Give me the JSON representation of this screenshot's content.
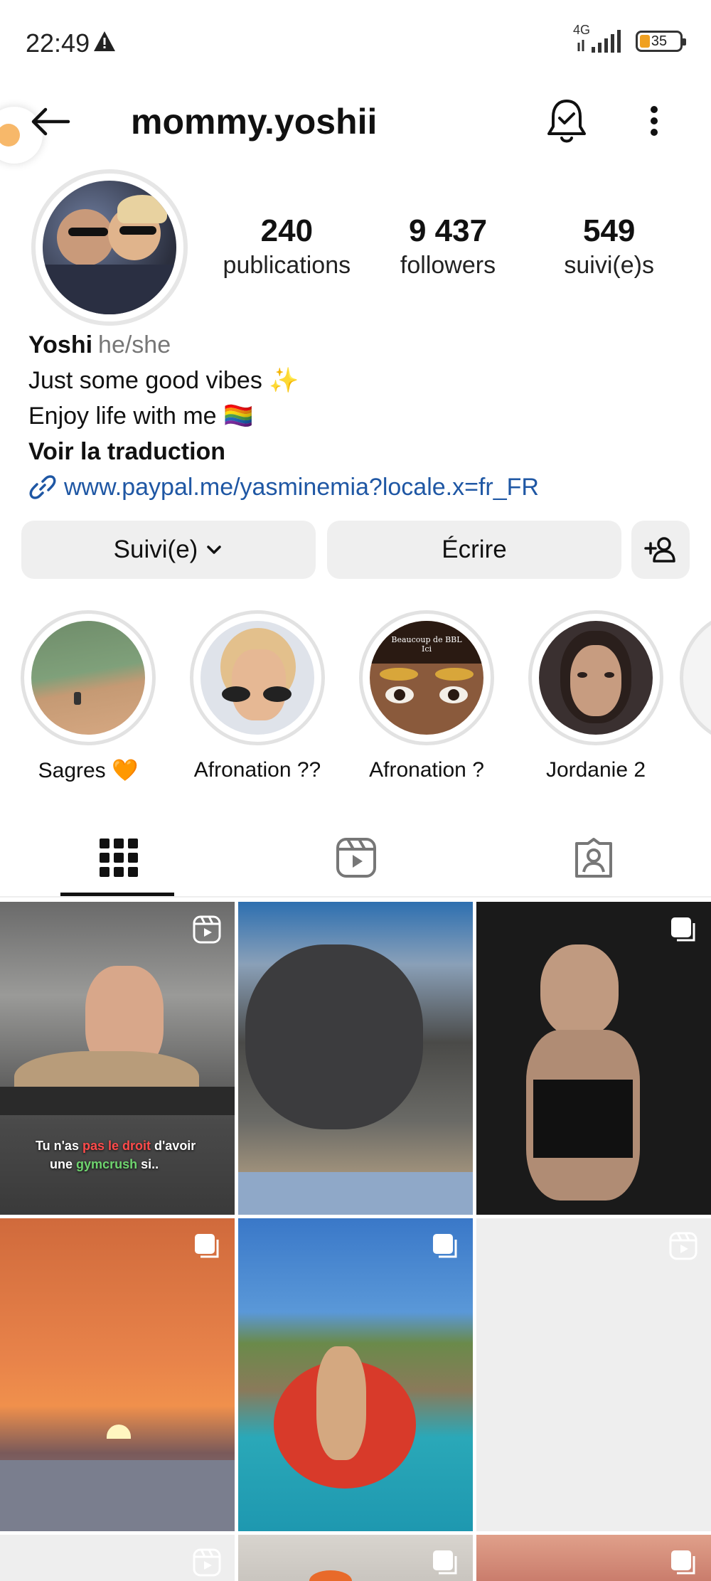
{
  "status_bar": {
    "time": "22:49",
    "network": "4G",
    "battery": "35"
  },
  "header": {
    "username": "mommy.yoshii"
  },
  "profile": {
    "stats": [
      {
        "value": "240",
        "label": "publications"
      },
      {
        "value": "9 437",
        "label": "followers"
      },
      {
        "value": "549",
        "label": "suivi(e)s"
      }
    ],
    "bio": {
      "name": "Yoshi",
      "pronouns": "he/she",
      "line1": "Just some good vibes ✨",
      "line2": "Enjoy life with me 🏳️‍🌈",
      "translate": "Voir la traduction",
      "link": "www.paypal.me/yasminemia?locale.x=fr_FR"
    }
  },
  "actions": {
    "follow_label": "Suivi(e)",
    "message_label": "Écrire"
  },
  "highlights": [
    {
      "label": "Sagres 🧡"
    },
    {
      "label": "Afronation ??"
    },
    {
      "label": "Afronation ?"
    },
    {
      "label": "Jordanie 2"
    }
  ],
  "highlight_overlay_text": "Beaucoup de BBL Ici",
  "grid": {
    "post1_caption_a": "Tu n'as",
    "post1_caption_red": "pas le droit",
    "post1_caption_b": "d'avoir",
    "post1_caption_c": "une",
    "post1_caption_green": "gymcrush",
    "post1_caption_d": "si.."
  }
}
